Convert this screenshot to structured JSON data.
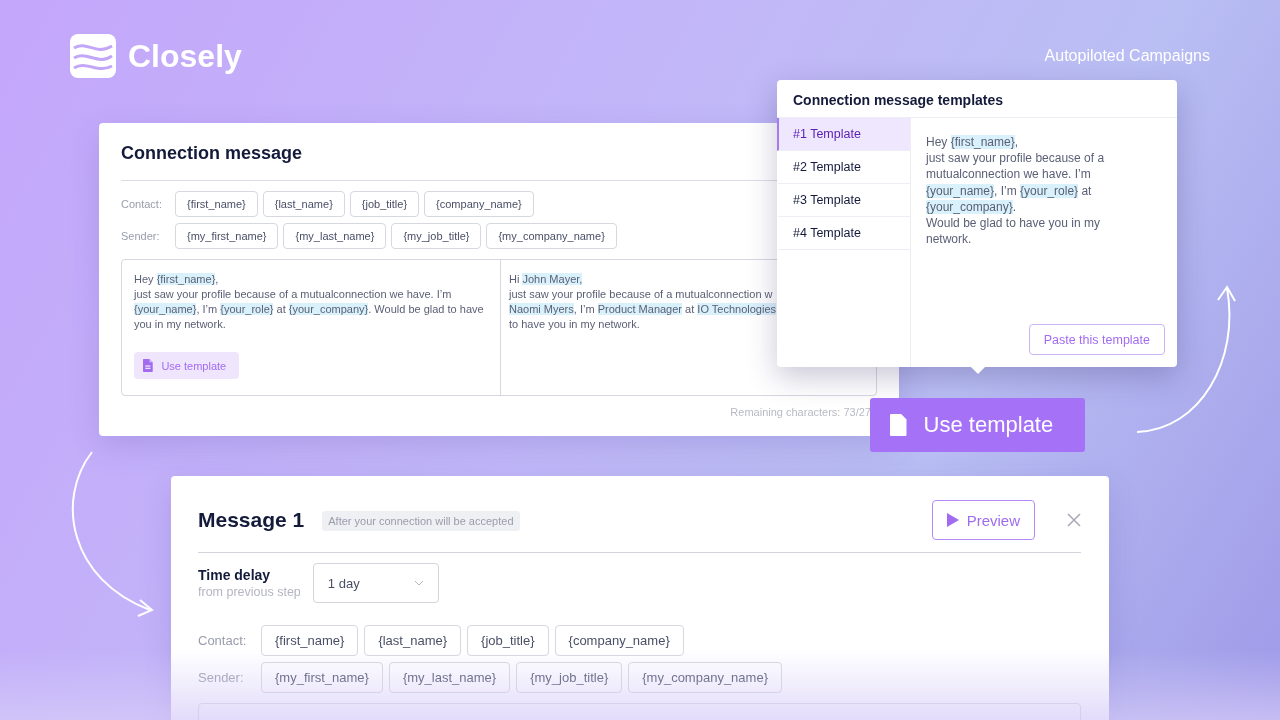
{
  "brand": {
    "name": "Closely"
  },
  "header_link": "Autopiloted Campaigns",
  "connection_card": {
    "title": "Connection message",
    "variable_rows": [
      {
        "label": "Contact:",
        "chips": [
          "{first_name}",
          "{last_name}",
          "{job_title}",
          "{company_name}"
        ]
      },
      {
        "label": "Sender:",
        "chips": [
          "{my_first_name}",
          "{my_last_name}",
          "{my_job_title}",
          "{my_company_name}"
        ]
      }
    ],
    "editor_lines": [
      [
        {
          "text": "Hey ",
          "highlighted": false
        },
        {
          "text": "{first_name}",
          "highlighted": true
        },
        {
          "text": ",",
          "highlighted": false
        }
      ],
      [
        {
          "text": "just saw your profile because of a mutualconnection we have. I’m",
          "highlighted": false
        }
      ],
      [
        {
          "text": "{your_name}",
          "highlighted": true
        },
        {
          "text": ", I’m ",
          "highlighted": false
        },
        {
          "text": "{your_role}",
          "highlighted": true
        },
        {
          "text": " at ",
          "highlighted": false
        },
        {
          "text": "{your_company}",
          "highlighted": true
        },
        {
          "text": ". Would be glad to have",
          "highlighted": false
        }
      ],
      [
        {
          "text": "you in my network.",
          "highlighted": false
        }
      ]
    ],
    "use_template_button": "Use template",
    "preview_lines": [
      [
        {
          "text": "Hi ",
          "highlighted": false
        },
        {
          "text": "John Mayer,",
          "highlighted": true
        }
      ],
      [
        {
          "text": "just saw your profile because of a mutualconnection w",
          "highlighted": false
        }
      ],
      [
        {
          "text": "Naomi Myers",
          "highlighted": true
        },
        {
          "text": ", I’m ",
          "highlighted": false
        },
        {
          "text": "Product Manager",
          "highlighted": true
        },
        {
          "text": " at ",
          "highlighted": false
        },
        {
          "text": "IO Technologies",
          "highlighted": true
        }
      ],
      [
        {
          "text": "to have you in my network.",
          "highlighted": false
        }
      ]
    ],
    "remaining": "Remaining characters: 73/27"
  },
  "templates_popup": {
    "title": "Connection message templates",
    "items": [
      {
        "label": "#1 Template",
        "selected": true
      },
      {
        "label": "#2 Template",
        "selected": false
      },
      {
        "label": "#3 Template",
        "selected": false
      },
      {
        "label": "#4 Template",
        "selected": false
      }
    ],
    "body_lines": [
      [
        {
          "text": "Hey ",
          "highlighted": false
        },
        {
          "text": "{first_name}",
          "highlighted": true
        },
        {
          "text": ",",
          "highlighted": false
        }
      ],
      [
        {
          "text": "just saw your profile because of a",
          "highlighted": false
        }
      ],
      [
        {
          "text": "mutualconnection we have. I’m",
          "highlighted": false
        }
      ],
      [
        {
          "text": "{your_name}",
          "highlighted": true
        },
        {
          "text": ", I’m ",
          "highlighted": false
        },
        {
          "text": "{your_role}",
          "highlighted": true
        },
        {
          "text": " at",
          "highlighted": false
        }
      ],
      [
        {
          "text": "{your_company}",
          "highlighted": true
        },
        {
          "text": ".",
          "highlighted": false
        }
      ],
      [
        {
          "text": "Would be glad to have you in my",
          "highlighted": false
        }
      ],
      [
        {
          "text": "network.",
          "highlighted": false
        }
      ]
    ],
    "paste_button": "Paste this template"
  },
  "use_template_button": "Use template",
  "message_card": {
    "title": "Message 1",
    "badge": "After your connection will be accepted",
    "preview_button": "Preview",
    "time_delay": {
      "label": "Time delay",
      "sublabel": "from previous step",
      "value": "1 day"
    },
    "variable_rows": [
      {
        "label": "Contact:",
        "chips": [
          "{first_name}",
          "{last_name}",
          "{job_title}",
          "{company_name}"
        ]
      },
      {
        "label": "Sender:",
        "chips": [
          "{my_first_name}",
          "{my_last_name}",
          "{my_job_title}",
          "{my_company_name}"
        ]
      }
    ]
  }
}
